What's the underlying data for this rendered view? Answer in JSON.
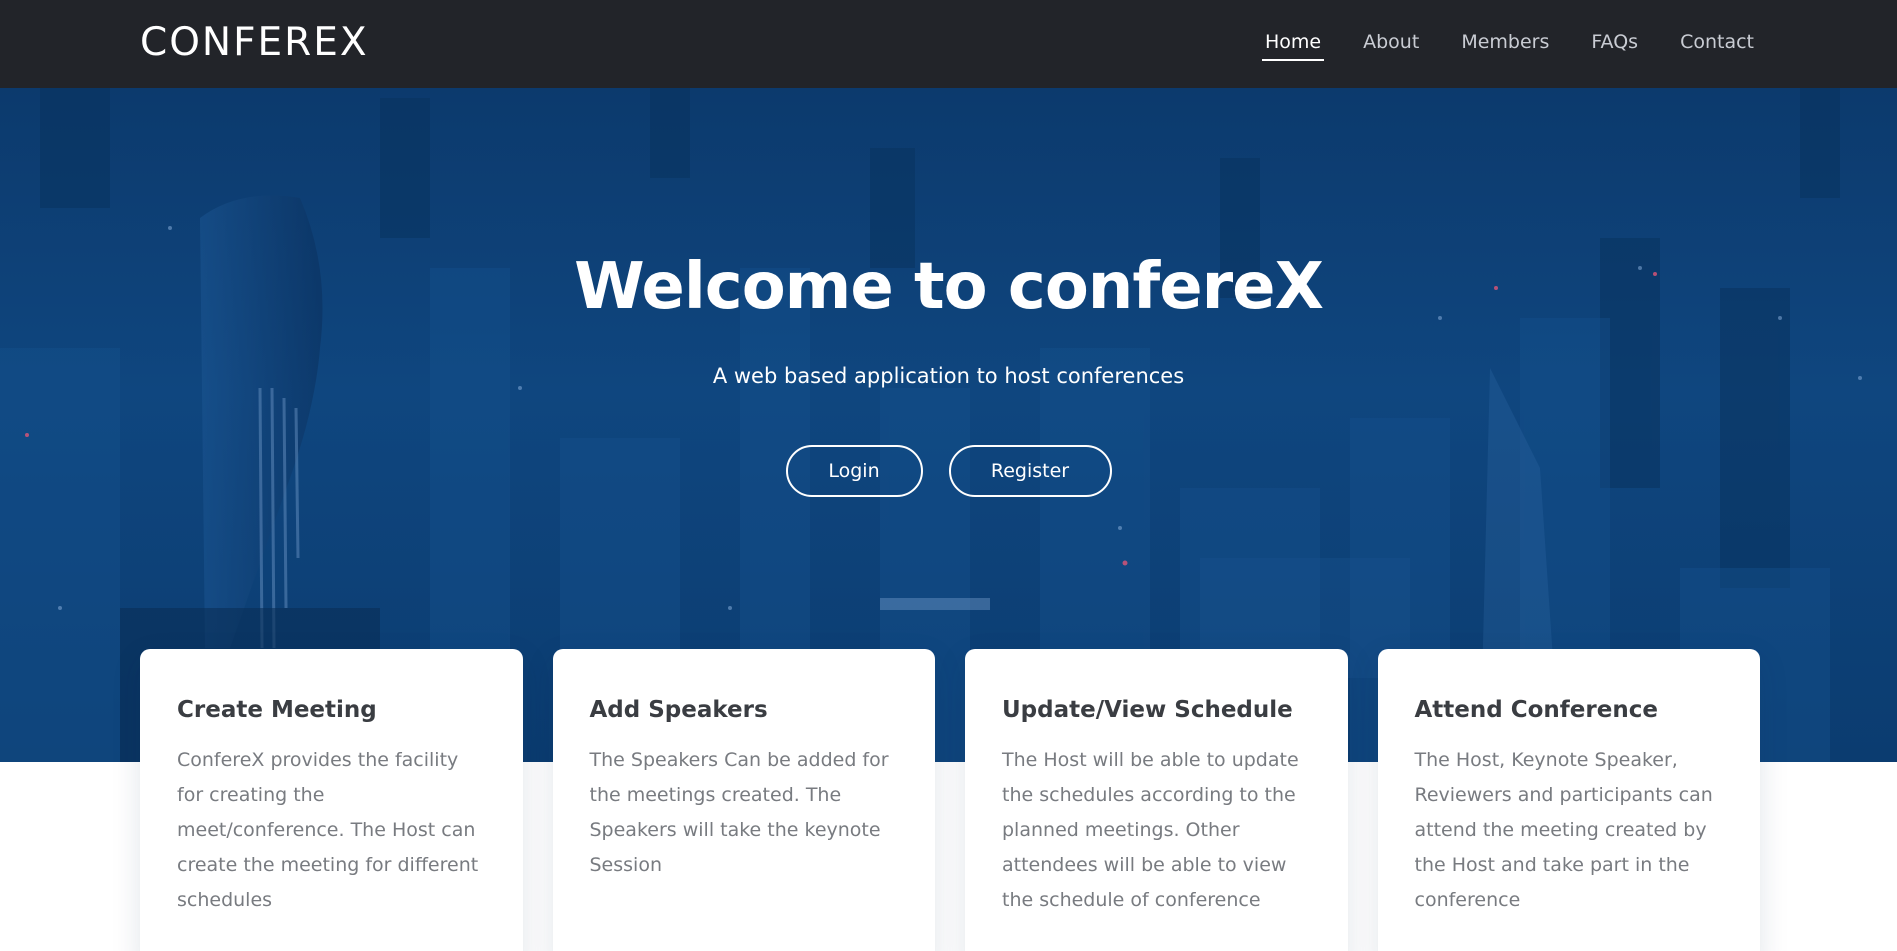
{
  "brand": "CONFEREX",
  "nav": {
    "home": "Home",
    "about": "About",
    "members": "Members",
    "faqs": "FAQs",
    "contact": "Contact"
  },
  "hero": {
    "title": "Welcome to confereX",
    "subtitle": "A web based application to host conferences",
    "login_label": "Login",
    "register_label": "Register"
  },
  "cards": [
    {
      "title": "Create Meeting",
      "text": "ConfereX provides the facility for creating the meet/conference. The Host can create the meeting for different schedules"
    },
    {
      "title": "Add Speakers",
      "text": "The Speakers Can be added for the meetings created. The Speakers will take the keynote Session"
    },
    {
      "title": "Update/View Schedule",
      "text": "The Host will be able to update the schedules according to the planned meetings. Other attendees will be able to view the schedule of conference"
    },
    {
      "title": "Attend Conference",
      "text": "The Host, Keynote Speaker, Reviewers and participants can attend the meeting created by the Host and take part in the conference"
    }
  ],
  "colors": {
    "navbar_bg": "#222429",
    "hero_blue": "#0f467f",
    "card_title": "#3a3d42",
    "card_text": "#787b80"
  }
}
